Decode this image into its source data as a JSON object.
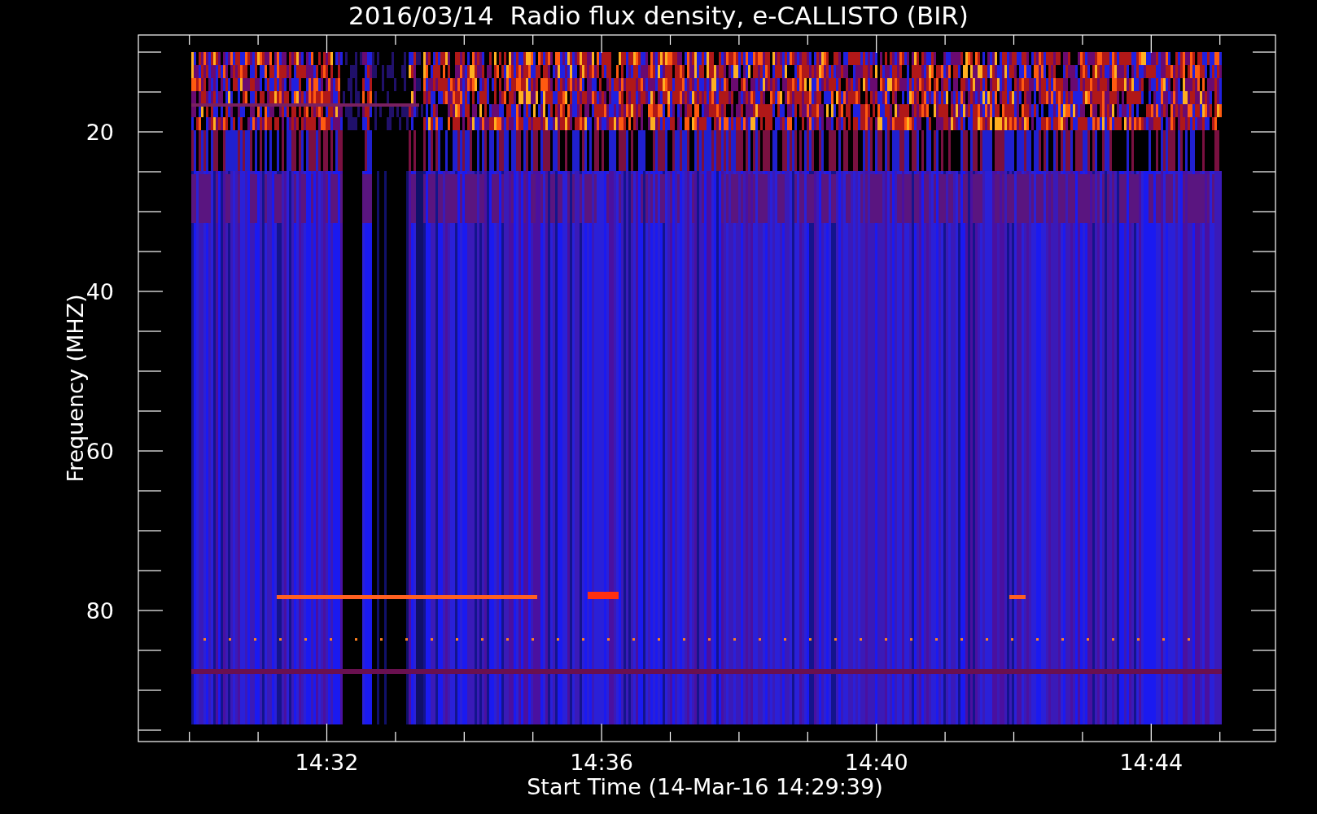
{
  "plot": {
    "title": "2016/03/14  Radio flux density, e-CALLISTO (BIR)",
    "xlabel": "Start Time (14-Mar-16 14:29:39)",
    "ylabel": "Frequency (MHZ)",
    "y_tick_labels": [
      "20",
      "40",
      "60",
      "80"
    ],
    "x_tick_labels": [
      "14:32",
      "14:36",
      "14:40",
      "14:44"
    ]
  }
}
